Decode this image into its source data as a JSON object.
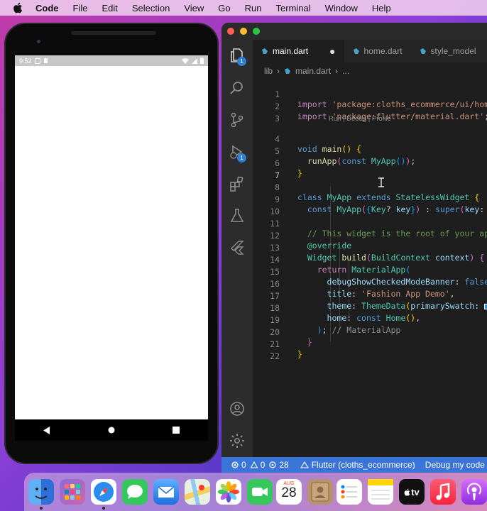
{
  "menubar": {
    "app": "Code",
    "items": [
      "File",
      "Edit",
      "Selection",
      "View",
      "Go",
      "Run",
      "Terminal",
      "Window",
      "Help"
    ]
  },
  "emulator": {
    "status_time": "9:52"
  },
  "editor": {
    "tabs": [
      {
        "label": "main.dart",
        "active": true,
        "modified": true
      },
      {
        "label": "home.dart",
        "active": false
      },
      {
        "label": "style_model",
        "active": false
      }
    ],
    "breadcrumb": [
      "lib",
      "main.dart",
      "..."
    ],
    "codelens": "Run | Debug | Profile",
    "lines": [
      {
        "n": "1",
        "text": "import 'package:cloths_ecommerce/ui/home"
      },
      {
        "n": "2",
        "text": "import 'package:flutter/material.dart';"
      },
      {
        "n": "3",
        "text": ""
      },
      {
        "n": "4",
        "text": "void main() {"
      },
      {
        "n": "5",
        "text": "  runApp(const MyApp());"
      },
      {
        "n": "6",
        "text": "}"
      },
      {
        "n": "7",
        "text": ""
      },
      {
        "n": "8",
        "text": "class MyApp extends StatelessWidget {"
      },
      {
        "n": "9",
        "text": "  const MyApp({Key? key}) : super(key: k"
      },
      {
        "n": "10",
        "text": ""
      },
      {
        "n": "11",
        "text": "  // This widget is the root of your app"
      },
      {
        "n": "12",
        "text": "  @override"
      },
      {
        "n": "13",
        "text": "  Widget build(BuildContext context) {"
      },
      {
        "n": "14",
        "text": "    return MaterialApp("
      },
      {
        "n": "15",
        "text": "      debugShowCheckedModeBanner: false"
      },
      {
        "n": "16",
        "text": "      title: 'Fashion App Demo',"
      },
      {
        "n": "17",
        "text": "      theme: ThemeData(primarySwatch: "
      },
      {
        "n": "18",
        "text": "      home: const Home(),"
      },
      {
        "n": "19",
        "text": "    ); // MaterialApp"
      },
      {
        "n": "20",
        "text": "  }"
      },
      {
        "n": "21",
        "text": "}"
      },
      {
        "n": "22",
        "text": ""
      }
    ]
  },
  "activity_badges": {
    "explorer": "1",
    "debug": "1"
  },
  "statusbar": {
    "errors": "0",
    "warnings": "0",
    "ports": "28",
    "flutter": "Flutter (cloths_ecommerce)",
    "debug": "Debug my code"
  },
  "dock": {
    "calendar_month": "AUG",
    "calendar_day": "28",
    "tv_label": "tv"
  }
}
